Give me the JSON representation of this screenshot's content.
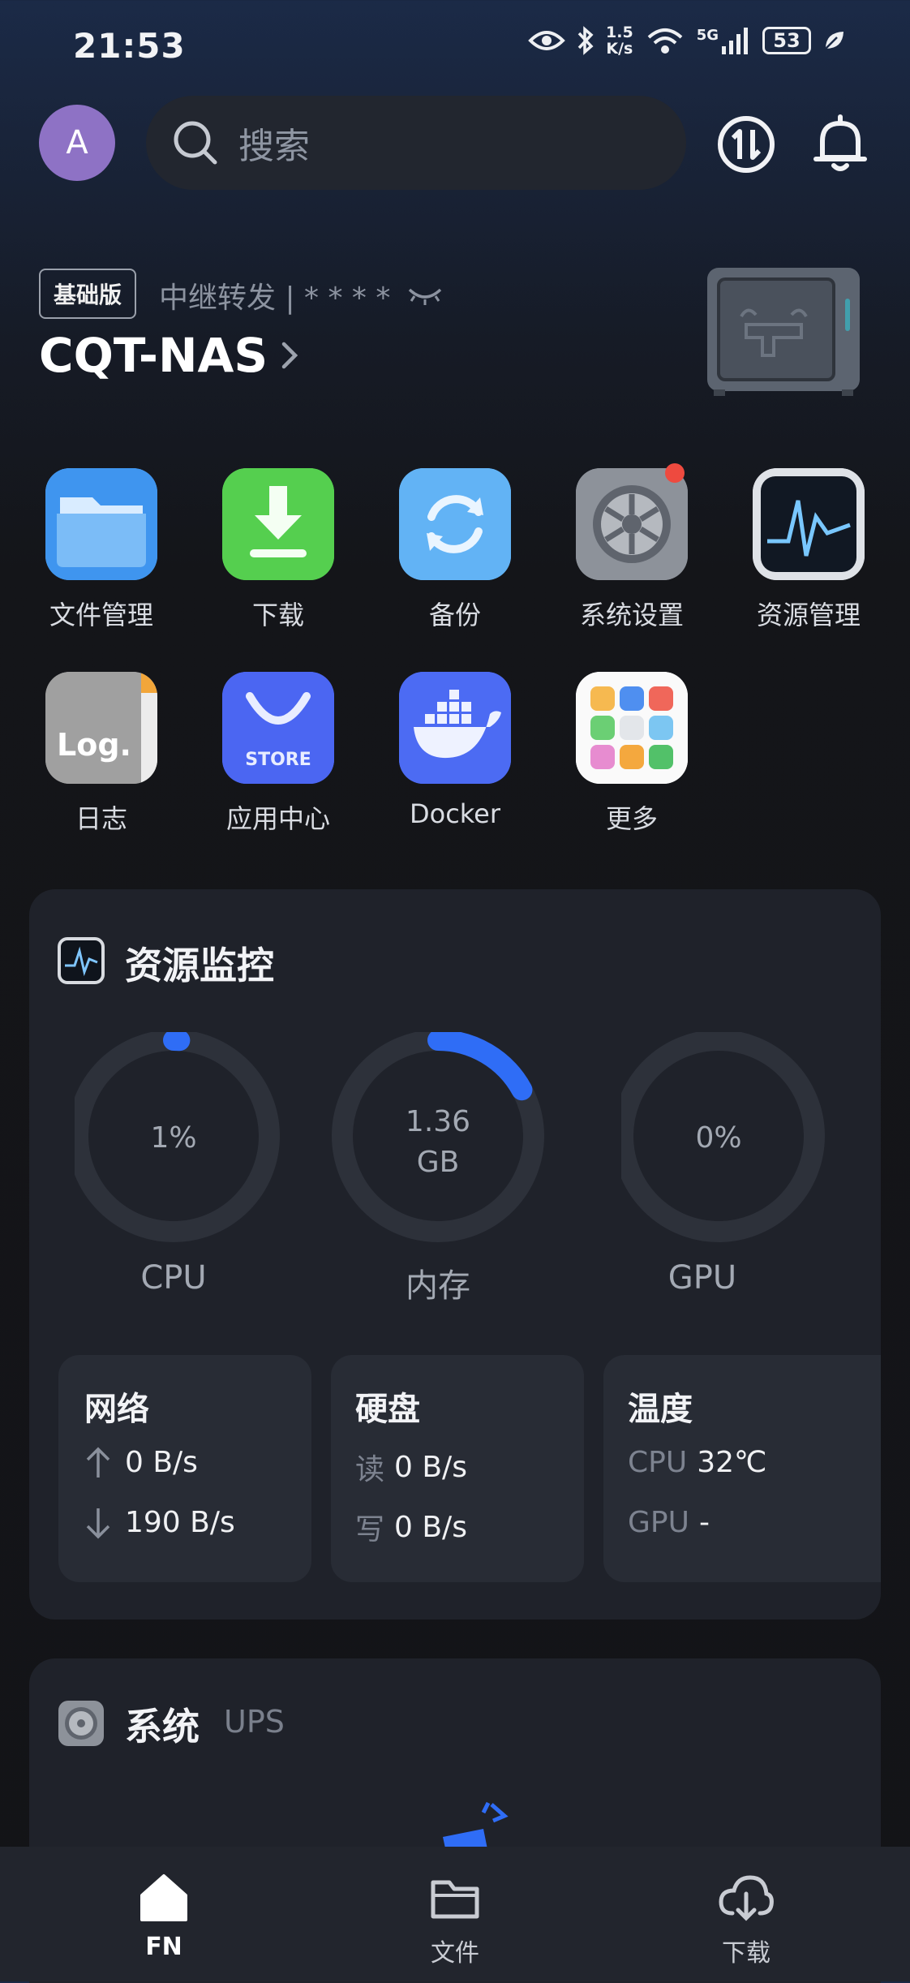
{
  "status_bar": {
    "time": "21:53",
    "net_speed_top": "1.5",
    "net_speed_bottom": "K/s",
    "signal_label": "5G",
    "battery": "53"
  },
  "header": {
    "avatar_letter": "A",
    "search_placeholder": "搜索"
  },
  "nas": {
    "edition_badge": "基础版",
    "relay_text": "中继转发 | * * * *",
    "name": "CQT-NAS"
  },
  "apps": [
    {
      "label": "文件管理"
    },
    {
      "label": "下载"
    },
    {
      "label": "备份"
    },
    {
      "label": "系统设置",
      "has_notification": true
    },
    {
      "label": "资源管理"
    },
    {
      "label": "日志",
      "icon_text": "Log."
    },
    {
      "label": "应用中心",
      "icon_text": "STORE"
    },
    {
      "label": "Docker"
    },
    {
      "label": "更多"
    }
  ],
  "resource_monitor": {
    "title": "资源监控",
    "cpu": {
      "value": "1%",
      "label": "CPU",
      "usage_fraction": 0.01
    },
    "memory": {
      "value_line1": "1.36",
      "value_line2": "GB",
      "label": "内存",
      "usage_fraction": 0.17
    },
    "gpu": {
      "value": "0%",
      "label": "GPU",
      "usage_fraction": 0
    },
    "network": {
      "title": "网络",
      "up": "0 B/s",
      "down": "190 B/s"
    },
    "disk": {
      "title": "硬盘",
      "read_label": "读",
      "read": "0 B/s",
      "write_label": "写",
      "write": "0 B/s"
    },
    "temperature": {
      "title": "温度",
      "cpu_label": "CPU",
      "cpu": "32℃",
      "gpu_label": "GPU",
      "gpu": "-"
    }
  },
  "system_card": {
    "title": "系统",
    "subtitle": "UPS"
  },
  "bottom_nav": [
    {
      "label": "FN",
      "active": true
    },
    {
      "label": "文件"
    },
    {
      "label": "下载"
    }
  ],
  "colors": {
    "accent": "#2f6df6",
    "avatar": "#8e72c5",
    "card": "#1f222a"
  }
}
